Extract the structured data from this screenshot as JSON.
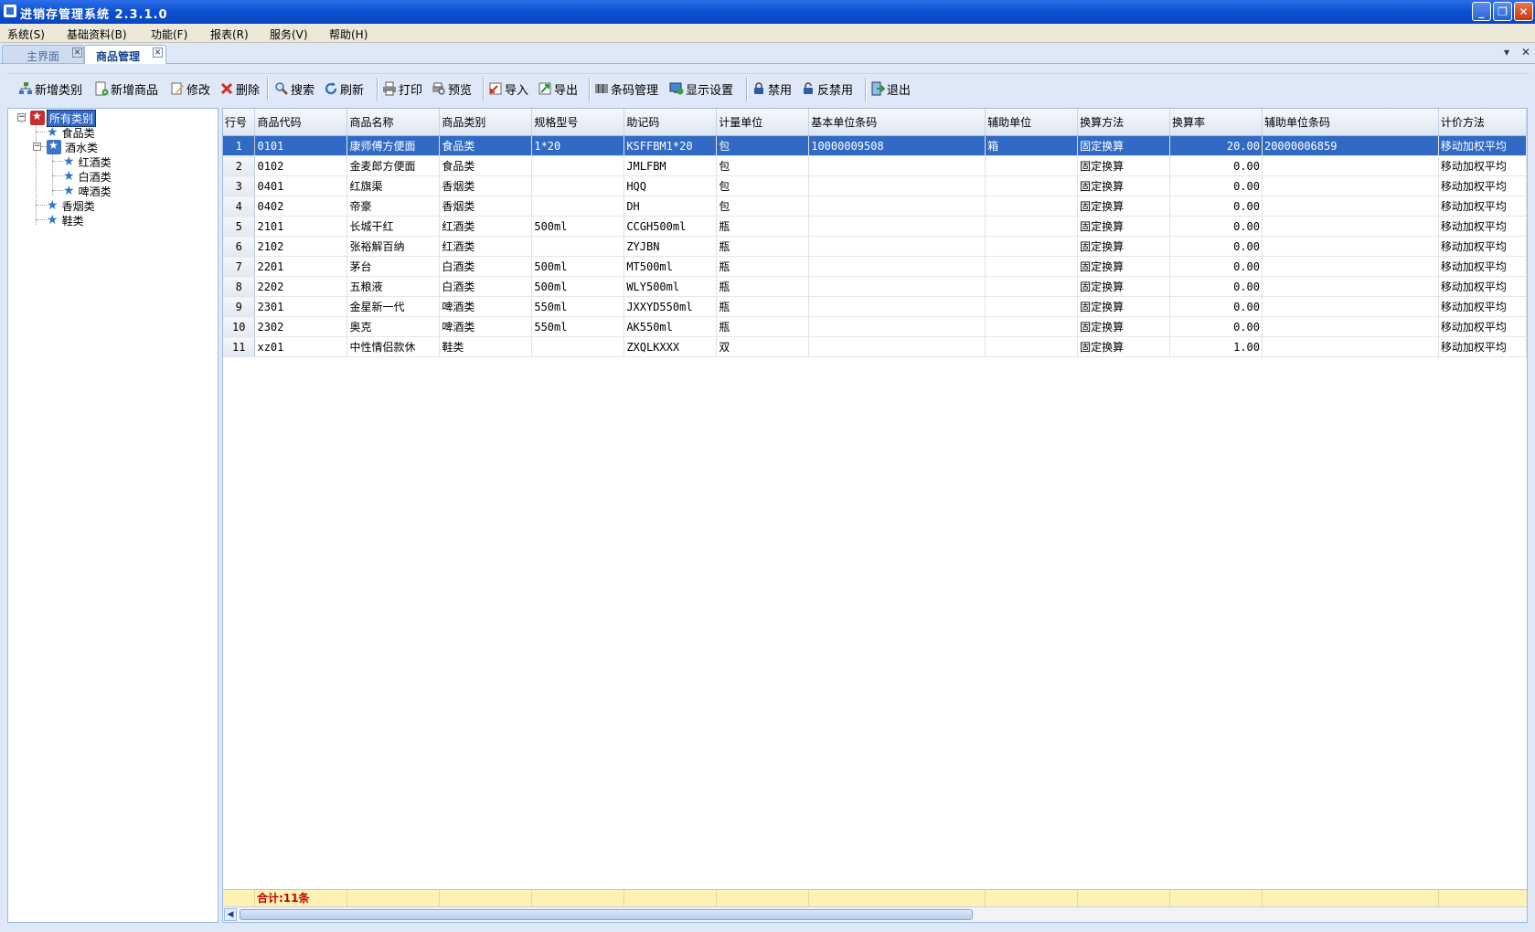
{
  "window": {
    "title": "进销存管理系统 2.3.1.0"
  },
  "menu": [
    "系统(S)",
    "基础资料(B)",
    "功能(F)",
    "报表(R)",
    "服务(V)",
    "帮助(H)"
  ],
  "tabs": [
    {
      "label": "主界面",
      "active": false
    },
    {
      "label": "商品管理",
      "active": true
    }
  ],
  "toolbar": {
    "add_category": "新增类别",
    "add_product": "新增商品",
    "edit": "修改",
    "delete": "删除",
    "search": "搜索",
    "refresh": "刷新",
    "print": "打印",
    "preview": "预览",
    "import": "导入",
    "export": "导出",
    "barcode": "条码管理",
    "display_settings": "显示设置",
    "disable": "禁用",
    "enable": "反禁用",
    "exit": "退出"
  },
  "tree": {
    "root": "所有类别",
    "food": "食品类",
    "drinks": "酒水类",
    "red_wine": "红酒类",
    "baijiu": "白酒类",
    "beer": "啤酒类",
    "tobacco": "香烟类",
    "shoes": "鞋类"
  },
  "table": {
    "columns": [
      "行号",
      "商品代码",
      "商品名称",
      "商品类别",
      "规格型号",
      "助记码",
      "计量单位",
      "基本单位条码",
      "辅助单位",
      "换算方法",
      "换算率",
      "辅助单位条码",
      "计价方法"
    ],
    "rows": [
      [
        "1",
        "0101",
        "康师傅方便面",
        "食品类",
        "1*20",
        "KSFFBM1*20",
        "包",
        "10000009508",
        "箱",
        "固定换算",
        "20.00",
        "20000006859",
        "移动加权平均"
      ],
      [
        "2",
        "0102",
        "金麦郎方便面",
        "食品类",
        "",
        "JMLFBM",
        "包",
        "",
        "",
        "固定换算",
        "0.00",
        "",
        "移动加权平均"
      ],
      [
        "3",
        "0401",
        "红旗渠",
        "香烟类",
        "",
        "HQQ",
        "包",
        "",
        "",
        "固定换算",
        "0.00",
        "",
        "移动加权平均"
      ],
      [
        "4",
        "0402",
        "帝豪",
        "香烟类",
        "",
        "DH",
        "包",
        "",
        "",
        "固定换算",
        "0.00",
        "",
        "移动加权平均"
      ],
      [
        "5",
        "2101",
        "长城干红",
        "红酒类",
        "500ml",
        "CCGH500ml",
        "瓶",
        "",
        "",
        "固定换算",
        "0.00",
        "",
        "移动加权平均"
      ],
      [
        "6",
        "2102",
        "张裕解百纳",
        "红酒类",
        "",
        "ZYJBN",
        "瓶",
        "",
        "",
        "固定换算",
        "0.00",
        "",
        "移动加权平均"
      ],
      [
        "7",
        "2201",
        "茅台",
        "白酒类",
        "500ml",
        "MT500ml",
        "瓶",
        "",
        "",
        "固定换算",
        "0.00",
        "",
        "移动加权平均"
      ],
      [
        "8",
        "2202",
        "五粮液",
        "白酒类",
        "500ml",
        "WLY500ml",
        "瓶",
        "",
        "",
        "固定换算",
        "0.00",
        "",
        "移动加权平均"
      ],
      [
        "9",
        "2301",
        "金星新一代",
        "啤酒类",
        "550ml",
        "JXXYD550ml",
        "瓶",
        "",
        "",
        "固定换算",
        "0.00",
        "",
        "移动加权平均"
      ],
      [
        "10",
        "2302",
        "奥克",
        "啤酒类",
        "550ml",
        "AK550ml",
        "瓶",
        "",
        "",
        "固定换算",
        "0.00",
        "",
        "移动加权平均"
      ],
      [
        "11",
        "xz01",
        "中性情侣款休",
        "鞋类",
        "",
        "ZXQLKXXX",
        "双",
        "",
        "",
        "固定换算",
        "1.00",
        "",
        "移动加权平均"
      ]
    ],
    "selected_row": 0,
    "footer_total": "合计:11条"
  },
  "colors": {
    "titlebar": "#0b4fd0",
    "selection": "#316ac5",
    "footer_bg": "#fdf1b4",
    "footer_text": "#c00000"
  }
}
